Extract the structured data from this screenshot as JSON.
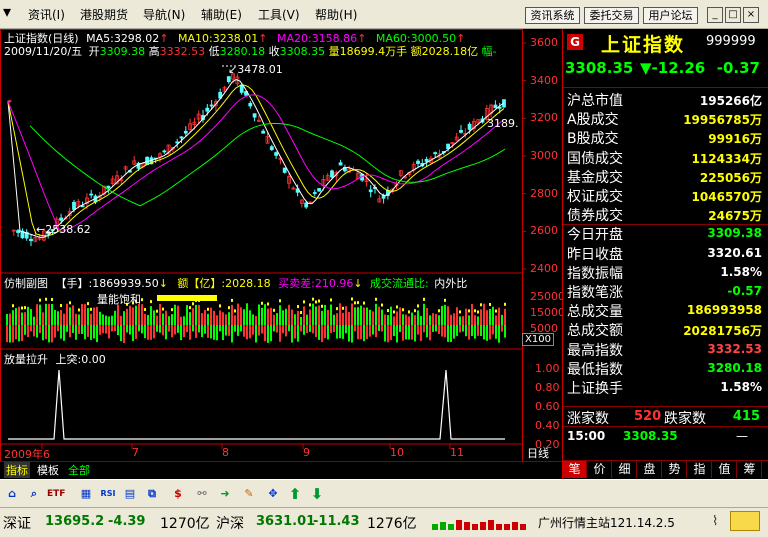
{
  "menu": [
    "资讯(I)",
    "港股期货",
    "导航(N)",
    "辅助(E)",
    "工具(V)",
    "帮助(H)"
  ],
  "top_buttons": [
    "资讯系统",
    "委托交易",
    "用户论坛"
  ],
  "window_controls": [
    "_",
    "□",
    "×"
  ],
  "chart": {
    "title": "上证指数(日线)",
    "ma5": "MA5:3298.02",
    "ma10": "MA10:3238.01",
    "ma20": "MA20:3158.86",
    "ma60": "MA60:3000.50",
    "info_date": "2009/11/20/五",
    "info_open_label": "开",
    "info_open": "3309.38",
    "info_high_label": "高",
    "info_high": "3332.53",
    "info_low_label": "低",
    "info_low": "3280.18",
    "info_vol_label": "收",
    "info_close": "3308.35",
    "info_amount": "量18699.4万手",
    "info_money": "额2028.18亿",
    "info_more": "幅-",
    "y_labels": [
      "3600",
      "3400",
      "3200",
      "3000",
      "2800",
      "2600",
      "2400"
    ],
    "y_values": [
      3600,
      3400,
      3200,
      3000,
      2800,
      2600,
      2400
    ],
    "high_label": "3478.01",
    "low_label": "2538.62",
    "last_label": "3189.",
    "sub_title": "仿制副图",
    "sub_hand": "【手】:1869939.50",
    "sub_yi": "额【亿】:2028.18",
    "sub_buysell": "买卖差:210.96",
    "sub_flow": "成交流通比:",
    "sub_inout": "内外比",
    "sub_note": "量能饱和",
    "sub_y": [
      "25000",
      "15000",
      "5000"
    ],
    "sub_unit": "X100",
    "vol_title": "放量拉升",
    "vol_sub": "上突:0.00",
    "vol_y": [
      "1.00",
      "0.80",
      "0.60",
      "0.40",
      "0.20"
    ],
    "x_labels": [
      "2009年6",
      "7",
      "8",
      "9",
      "10",
      "11"
    ],
    "period": "日线",
    "bottom_tabs": [
      "指标",
      "模板",
      "全部"
    ]
  },
  "chart_data": {
    "type": "candlestick",
    "x_start": "2009-06",
    "x_labels": [
      "2009年6",
      "7",
      "8",
      "9",
      "10",
      "11"
    ],
    "ylim": [
      2400,
      3600
    ],
    "high": 3478.01,
    "low": 2538.62,
    "last": {
      "open": 3309.38,
      "high": 3332.53,
      "low": 3280.18,
      "close": 3308.35
    },
    "ma": {
      "MA5": 3298.02,
      "MA10": 3238.01,
      "MA20": 3158.86,
      "MA60": 3000.5
    }
  },
  "quote": {
    "badge": "G",
    "name": "上证指数",
    "code": "999999",
    "price": "3308.35",
    "change": "▼-12.26",
    "pct": "-0.37",
    "rows": [
      {
        "label": "沪总市值",
        "value": "195266亿",
        "color": "#fff"
      },
      {
        "label": "A股成交",
        "value": "19956785万",
        "color": "#ff0"
      },
      {
        "label": "B股成交",
        "value": "99916万",
        "color": "#ff0"
      },
      {
        "label": "国债成交",
        "value": "1124334万",
        "color": "#ff0"
      },
      {
        "label": "基金成交",
        "value": "225056万",
        "color": "#ff0"
      },
      {
        "label": "权证成交",
        "value": "1046570万",
        "color": "#ff0"
      },
      {
        "label": "债券成交",
        "value": "24675万",
        "color": "#ff0"
      },
      {
        "label": "今日开盘",
        "value": "3309.38",
        "color": "#0f0"
      },
      {
        "label": "昨日收盘",
        "value": "3320.61",
        "color": "#fff"
      },
      {
        "label": "指数振幅",
        "value": "1.58%",
        "color": "#fff"
      },
      {
        "label": "指数笔涨",
        "value": "-0.57",
        "color": "#0f0"
      },
      {
        "label": "总成交量",
        "value": "186993958",
        "color": "#ff0"
      },
      {
        "label": "总成交额",
        "value": "20281756万",
        "color": "#ff0"
      },
      {
        "label": "最高指数",
        "value": "3332.53",
        "color": "#f44"
      },
      {
        "label": "最低指数",
        "value": "3280.18",
        "color": "#0f0"
      },
      {
        "label": "上证换手",
        "value": "1.58%",
        "color": "#fff"
      }
    ],
    "up_label": "涨家数",
    "up_count": "520",
    "down_label": "跌家数",
    "down_count": "415",
    "tick_time": "15:00",
    "tick_price": "3308.35",
    "tick_dash": "—",
    "tabs": [
      "笔",
      "价",
      "细",
      "盘",
      "势",
      "指",
      "值",
      "筹"
    ]
  },
  "status": {
    "sz_name": "深证",
    "sz_val": "13695.2",
    "sz_chg": "-4.39",
    "sz_amt": "1270亿",
    "hs_name": "沪深",
    "hs_val": "3631.01",
    "hs_chg": "-11.43",
    "hs_amt": "1276亿",
    "server": "广州行情主站121.14.2.5"
  },
  "colors": {
    "up": "#ff3232",
    "down": "#54fcfc",
    "green": "#00ff00",
    "ma5": "#ffffff",
    "ma10": "#ffff00",
    "ma20": "#ff00ff",
    "ma60": "#00ff00"
  }
}
